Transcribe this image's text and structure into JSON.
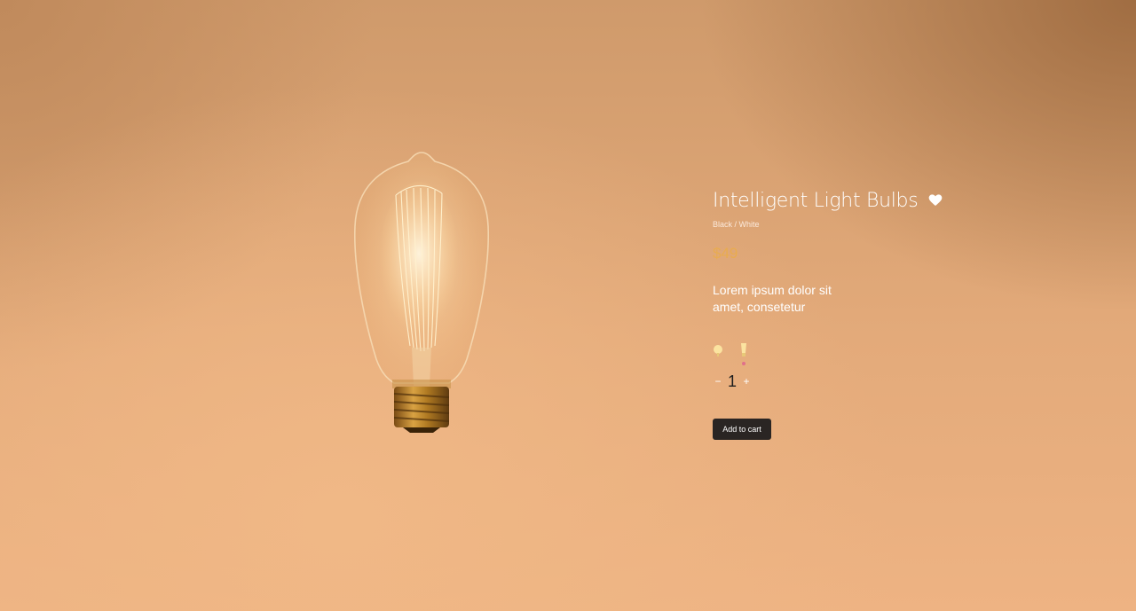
{
  "product": {
    "title": "Intelligent Light Bulbs",
    "variant": "Black / White",
    "price": "$49",
    "description": "Lorem ipsum dolor sit amet, consetetur"
  },
  "quantity": {
    "decrement_label": "−",
    "value": "1",
    "increment_label": "+"
  },
  "cart": {
    "add_label": "Add to cart"
  },
  "icons": {
    "wishlist": "heart-icon",
    "swatch_1": "round-bulb-icon",
    "swatch_2": "tall-bulb-icon"
  },
  "colors": {
    "price": "#e9ac4f",
    "button_bg": "#2a2523",
    "selected_indicator": "#e0708a"
  }
}
